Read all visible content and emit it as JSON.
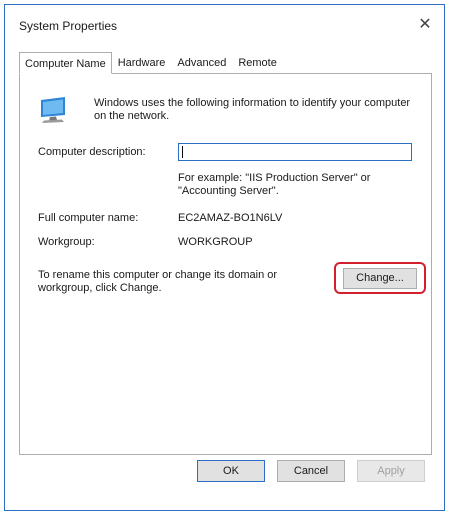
{
  "window": {
    "title": "System Properties",
    "close_glyph": "✕"
  },
  "tabs": [
    {
      "label": "Computer Name",
      "active": true
    },
    {
      "label": "Hardware",
      "active": false
    },
    {
      "label": "Advanced",
      "active": false
    },
    {
      "label": "Remote",
      "active": false
    }
  ],
  "computer_name_tab": {
    "icon": "computer-icon",
    "intro": "Windows uses the following information to identify your computer on the network.",
    "description_label": "Computer description:",
    "description_value": "",
    "example": "For example: \"IIS Production Server\" or \"Accounting Server\".",
    "full_name_label": "Full computer name:",
    "full_name_value": "EC2AMAZ-BO1N6LV",
    "workgroup_label": "Workgroup:",
    "workgroup_value": "WORKGROUP",
    "rename_text": "To rename this computer or change its domain or workgroup, click Change.",
    "change_label": "Change...",
    "highlight_color": "#d3202e"
  },
  "footer": {
    "ok_label": "OK",
    "cancel_label": "Cancel",
    "apply_label": "Apply",
    "apply_enabled": false
  },
  "colors": {
    "accent": "#2b6fc4",
    "button_face": "#e1e1e1"
  }
}
